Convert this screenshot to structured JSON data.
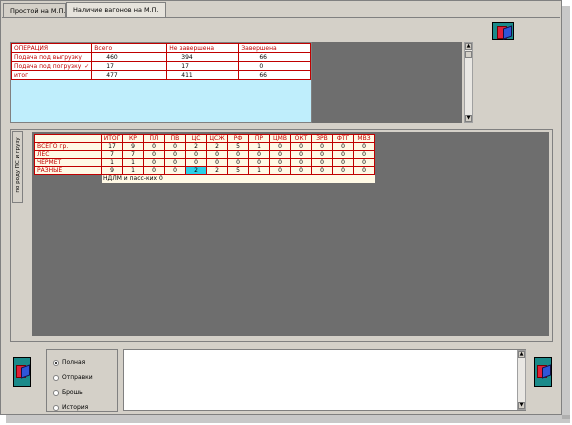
{
  "tabs": [
    {
      "label": "Простой на М.П.",
      "active": false
    },
    {
      "label": "Наличие вагонов на М.П.",
      "active": true
    }
  ],
  "operations_grid": {
    "columns": [
      "ОПЕРАЦИЯ",
      "Всего",
      "Не завершена",
      "Завершена"
    ],
    "rows": [
      {
        "op": "Подача под выгрузку",
        "mark": "",
        "total": "460",
        "unfinished": "394",
        "finished": "66"
      },
      {
        "op": "Подача под погрузку",
        "mark": "✓",
        "total": "17",
        "unfinished": "17",
        "finished": "0"
      },
      {
        "op": "итог",
        "mark": "",
        "total": "477",
        "unfinished": "411",
        "finished": "66"
      }
    ]
  },
  "side_tab": {
    "label": "по роду ПС и грузу"
  },
  "wagon_grid": {
    "columns": [
      "",
      "ИТОГ",
      "КР",
      "ПЛ",
      "ПВ",
      "ЦС",
      "ЦСЖ",
      "РФ",
      "ПР",
      "ЦМВ",
      "ОКТ",
      "ЗРВ",
      "ФТГ",
      "МВЗ"
    ],
    "rows": [
      {
        "label": "ВСЕГО   гр.",
        "values": [
          "17",
          "9",
          "0",
          "0",
          "2",
          "2",
          "5",
          "1",
          "0",
          "0",
          "0",
          "0",
          "0"
        ]
      },
      {
        "label": "ЛЕС",
        "values": [
          "7",
          "7",
          "0",
          "0",
          "0",
          "0",
          "0",
          "0",
          "0",
          "0",
          "0",
          "0",
          "0"
        ]
      },
      {
        "label": "ЧЕРМЕТ",
        "values": [
          "1",
          "1",
          "0",
          "0",
          "0",
          "0",
          "0",
          "0",
          "0",
          "0",
          "0",
          "0",
          "0"
        ]
      },
      {
        "label": "РАЗНЫЕ",
        "values": [
          "9",
          "1",
          "0",
          "0",
          "2",
          "2",
          "5",
          "1",
          "0",
          "0",
          "0",
          "0",
          "0"
        ]
      }
    ],
    "highlight": {
      "row": 3,
      "col": 4
    },
    "footer": "НДЛМ и пасс-ких   0"
  },
  "mode_options": [
    {
      "label": "Полная",
      "selected": true
    },
    {
      "label": "Отправки",
      "selected": false
    },
    {
      "label": "Брошь",
      "selected": false
    },
    {
      "label": "История",
      "selected": false
    }
  ],
  "memo_text": "",
  "colors": {
    "accent_red": "#c00000",
    "grid_cyan": "#bfeefc",
    "highlight_cyan": "#29d0e8",
    "dark_bg": "#6e6e6e"
  },
  "icons": [
    "refresh-icon",
    "scroll-up-icon",
    "scroll-down-icon"
  ]
}
